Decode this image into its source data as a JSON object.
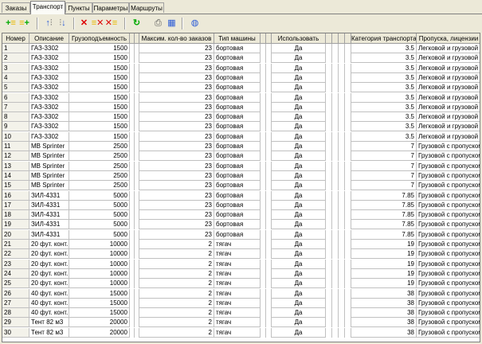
{
  "tabs": [
    "Заказы",
    "Транспорт",
    "Пункты",
    "Параметры",
    "Маршруты"
  ],
  "active_tab": 1,
  "toolbar_icons": [
    "add-row-icon",
    "insert-row-icon",
    "move-up-icon",
    "move-down-icon",
    "delete-row-icon",
    "delete-all-icon",
    "clear-icon",
    "refresh-icon",
    "print-icon",
    "table-icon",
    "globe-icon"
  ],
  "table": {
    "columns": [
      "Номер",
      "Описание",
      "Грузоподъемность",
      "Максим. кол-во заказов",
      "Тип машины",
      "Использовать",
      "Категория транспорта",
      "Пропуска, лицензии"
    ],
    "rows": [
      {
        "num": "1",
        "desc": "ГАЗ-3302",
        "cap": "1500",
        "max": "23",
        "type": "бортовая",
        "use": "Да",
        "cat": "3.5",
        "lic": "Легковой и грузовой"
      },
      {
        "num": "2",
        "desc": "ГАЗ-3302",
        "cap": "1500",
        "max": "23",
        "type": "бортовая",
        "use": "Да",
        "cat": "3.5",
        "lic": "Легковой и грузовой"
      },
      {
        "num": "3",
        "desc": "ГАЗ-3302",
        "cap": "1500",
        "max": "23",
        "type": "бортовая",
        "use": "Да",
        "cat": "3.5",
        "lic": "Легковой и грузовой"
      },
      {
        "num": "4",
        "desc": "ГАЗ-3302",
        "cap": "1500",
        "max": "23",
        "type": "бортовая",
        "use": "Да",
        "cat": "3.5",
        "lic": "Легковой и грузовой"
      },
      {
        "num": "5",
        "desc": "ГАЗ-3302",
        "cap": "1500",
        "max": "23",
        "type": "бортовая",
        "use": "Да",
        "cat": "3.5",
        "lic": "Легковой и грузовой"
      },
      {
        "num": "6",
        "desc": "ГАЗ-3302",
        "cap": "1500",
        "max": "23",
        "type": "бортовая",
        "use": "Да",
        "cat": "3.5",
        "lic": "Легковой и грузовой"
      },
      {
        "num": "7",
        "desc": "ГАЗ-3302",
        "cap": "1500",
        "max": "23",
        "type": "бортовая",
        "use": "Да",
        "cat": "3.5",
        "lic": "Легковой и грузовой"
      },
      {
        "num": "8",
        "desc": "ГАЗ-3302",
        "cap": "1500",
        "max": "23",
        "type": "бортовая",
        "use": "Да",
        "cat": "3.5",
        "lic": "Легковой и грузовой"
      },
      {
        "num": "9",
        "desc": "ГАЗ-3302",
        "cap": "1500",
        "max": "23",
        "type": "бортовая",
        "use": "Да",
        "cat": "3.5",
        "lic": "Легковой и грузовой"
      },
      {
        "num": "10",
        "desc": "ГАЗ-3302",
        "cap": "1500",
        "max": "23",
        "type": "бортовая",
        "use": "Да",
        "cat": "3.5",
        "lic": "Легковой и грузовой"
      },
      {
        "num": "11",
        "desc": "MB Sprinter",
        "cap": "2500",
        "max": "23",
        "type": "бортовая",
        "use": "Да",
        "cat": "7",
        "lic": "Грузовой с пропуском"
      },
      {
        "num": "12",
        "desc": "MB Sprinter",
        "cap": "2500",
        "max": "23",
        "type": "бортовая",
        "use": "Да",
        "cat": "7",
        "lic": "Грузовой с пропуском"
      },
      {
        "num": "13",
        "desc": "MB Sprinter",
        "cap": "2500",
        "max": "23",
        "type": "бортовая",
        "use": "Да",
        "cat": "7",
        "lic": "Грузовой с пропуском"
      },
      {
        "num": "14",
        "desc": "MB Sprinter",
        "cap": "2500",
        "max": "23",
        "type": "бортовая",
        "use": "Да",
        "cat": "7",
        "lic": "Грузовой с пропуском"
      },
      {
        "num": "15",
        "desc": "MB Sprinter",
        "cap": "2500",
        "max": "23",
        "type": "бортовая",
        "use": "Да",
        "cat": "7",
        "lic": "Грузовой с пропуском"
      },
      {
        "num": "16",
        "desc": "ЗИЛ-4331",
        "cap": "5000",
        "max": "23",
        "type": "бортовая",
        "use": "Да",
        "cat": "7.85",
        "lic": "Грузовой с пропуском"
      },
      {
        "num": "17",
        "desc": "ЗИЛ-4331",
        "cap": "5000",
        "max": "23",
        "type": "бортовая",
        "use": "Да",
        "cat": "7.85",
        "lic": "Грузовой с пропуском"
      },
      {
        "num": "18",
        "desc": "ЗИЛ-4331",
        "cap": "5000",
        "max": "23",
        "type": "бортовая",
        "use": "Да",
        "cat": "7.85",
        "lic": "Грузовой с пропуском"
      },
      {
        "num": "19",
        "desc": "ЗИЛ-4331",
        "cap": "5000",
        "max": "23",
        "type": "бортовая",
        "use": "Да",
        "cat": "7.85",
        "lic": "Грузовой с пропуском"
      },
      {
        "num": "20",
        "desc": "ЗИЛ-4331",
        "cap": "5000",
        "max": "23",
        "type": "бортовая",
        "use": "Да",
        "cat": "7.85",
        "lic": "Грузовой с пропуском"
      },
      {
        "num": "21",
        "desc": "20 фут. конт.",
        "cap": "10000",
        "max": "2",
        "type": "тягач",
        "use": "Да",
        "cat": "19",
        "lic": "Грузовой с пропуском"
      },
      {
        "num": "22",
        "desc": "20 фут. конт.",
        "cap": "10000",
        "max": "2",
        "type": "тягач",
        "use": "Да",
        "cat": "19",
        "lic": "Грузовой с пропуском"
      },
      {
        "num": "23",
        "desc": "20 фут. конт.",
        "cap": "10000",
        "max": "2",
        "type": "тягач",
        "use": "Да",
        "cat": "19",
        "lic": "Грузовой с пропуском"
      },
      {
        "num": "24",
        "desc": "20 фут. конт.",
        "cap": "10000",
        "max": "2",
        "type": "тягач",
        "use": "Да",
        "cat": "19",
        "lic": "Грузовой с пропуском"
      },
      {
        "num": "25",
        "desc": "20 фут. конт.",
        "cap": "10000",
        "max": "2",
        "type": "тягач",
        "use": "Да",
        "cat": "19",
        "lic": "Грузовой с пропуском"
      },
      {
        "num": "26",
        "desc": "40 фут. конт.",
        "cap": "15000",
        "max": "2",
        "type": "тягач",
        "use": "Да",
        "cat": "38",
        "lic": "Грузовой с пропуском"
      },
      {
        "num": "27",
        "desc": "40 фут. конт.",
        "cap": "15000",
        "max": "2",
        "type": "тягач",
        "use": "Да",
        "cat": "38",
        "lic": "Грузовой с пропуском"
      },
      {
        "num": "28",
        "desc": "40 фут. конт.",
        "cap": "15000",
        "max": "2",
        "type": "тягач",
        "use": "Да",
        "cat": "38",
        "lic": "Грузовой с пропуском"
      },
      {
        "num": "29",
        "desc": "Тент 82 м3",
        "cap": "20000",
        "max": "2",
        "type": "тягач",
        "use": "Да",
        "cat": "38",
        "lic": "Грузовой с пропуском"
      },
      {
        "num": "30",
        "desc": "Тент 82 м3",
        "cap": "20000",
        "max": "2",
        "type": "тягач",
        "use": "Да",
        "cat": "38",
        "lic": "Грузовой с пропуском"
      }
    ]
  }
}
